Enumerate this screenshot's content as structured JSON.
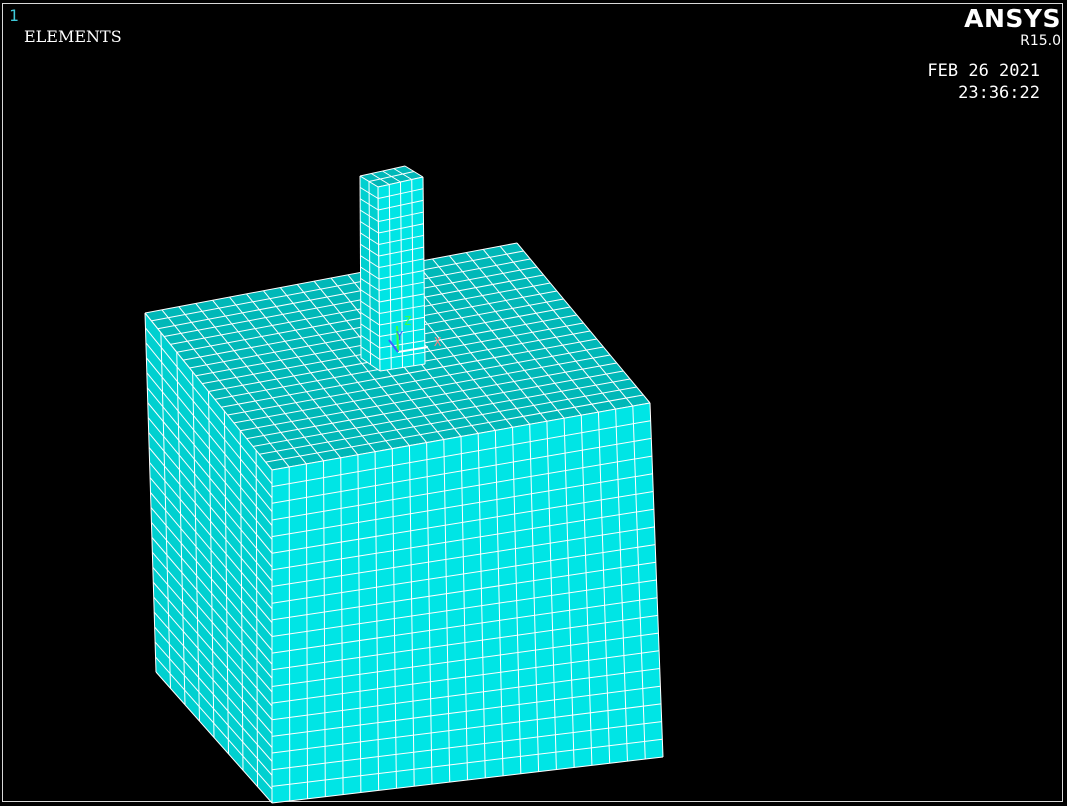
{
  "window": {
    "number": "1",
    "plot_label": "ELEMENTS"
  },
  "branding": {
    "product": "ANSYS",
    "version": "R15.0"
  },
  "timestamp": {
    "date": "FEB 26 2021",
    "time": "23:36:22"
  },
  "triad": {
    "z_label": "Z",
    "y_label": "Y",
    "x_label": "X"
  },
  "colors": {
    "background": "#000000",
    "element_fill": "#00e5e5",
    "element_shade_top": "#00b8b8",
    "element_shade_left": "#00d0d0",
    "mesh_line": "#ffffff",
    "axis_x": "#ff4040",
    "axis_y": "#4060ff",
    "axis_z": "#40ff40",
    "window_number": "#3fc8d8"
  }
}
